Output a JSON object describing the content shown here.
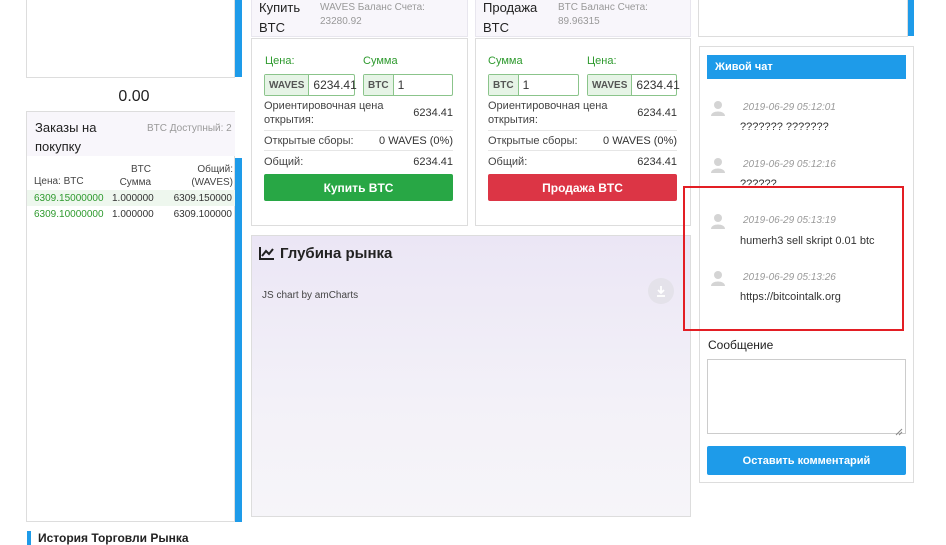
{
  "left": {
    "price_display": "0.00",
    "orders_title": "Заказы на покупку",
    "btc_available": "BTC Доступный: 2",
    "headers": {
      "price": "Цена: BTC",
      "amount": "BTC Сумма",
      "total": "Общий: (WAVES)"
    },
    "rows": [
      {
        "price": "6309.15000000",
        "amount": "1.000000",
        "total": "6309.150000"
      },
      {
        "price": "6309.10000000",
        "amount": "1.000000",
        "total": "6309.100000"
      }
    ]
  },
  "buy": {
    "title": "Купить BTC",
    "balance": "WAVES Баланс Счета: 23280.92",
    "price_label": "Цена:",
    "amount_label": "Сумма",
    "price_addon": "WAVES",
    "price_value": "6234.41",
    "amount_addon": "BTC",
    "amount_value": "1",
    "est_label": "Ориентировочная цена открытия:",
    "est_value": "6234.41",
    "fees_label": "Открытые сборы:",
    "fees_value": "0 WAVES (0%)",
    "total_label": "Общий:",
    "total_value": "6234.41",
    "button": "Купить BTC",
    "button_color": "#28a745"
  },
  "sell": {
    "title": "Продажа BTC",
    "balance": "BTC Баланс Счета: 89.96315",
    "amount_label": "Сумма",
    "price_label": "Цена:",
    "amount_addon": "BTC",
    "amount_value": "1",
    "price_addon": "WAVES",
    "price_value": "6234.41",
    "est_label": "Ориентировочная цена открытия:",
    "est_value": "6234.41",
    "fees_label": "Открытые сборы:",
    "fees_value": "0 WAVES (0%)",
    "total_label": "Общий:",
    "total_value": "6234.41",
    "button": "Продажа BTC",
    "button_color": "#dc3545"
  },
  "depth": {
    "title": "Глубина рынка",
    "credit": "JS chart by amCharts"
  },
  "chat": {
    "header": "Живой чат",
    "messages": [
      {
        "time": "2019-06-29 05:12:01",
        "text": "??????? ???????"
      },
      {
        "time": "2019-06-29 05:12:16",
        "text": "??????"
      },
      {
        "time": "2019-06-29 05:13:19",
        "text": "humerh3 sell skript 0.01 btc"
      },
      {
        "time": "2019-06-29 05:13:26",
        "text": "https://bitcointalk.org"
      }
    ],
    "message_label": "Сообщение",
    "submit": "Оставить комментарий"
  },
  "history_title": "История Торговли Рынка",
  "colors": {
    "accent": "#1e9be9",
    "highlight": "#e31e24"
  }
}
